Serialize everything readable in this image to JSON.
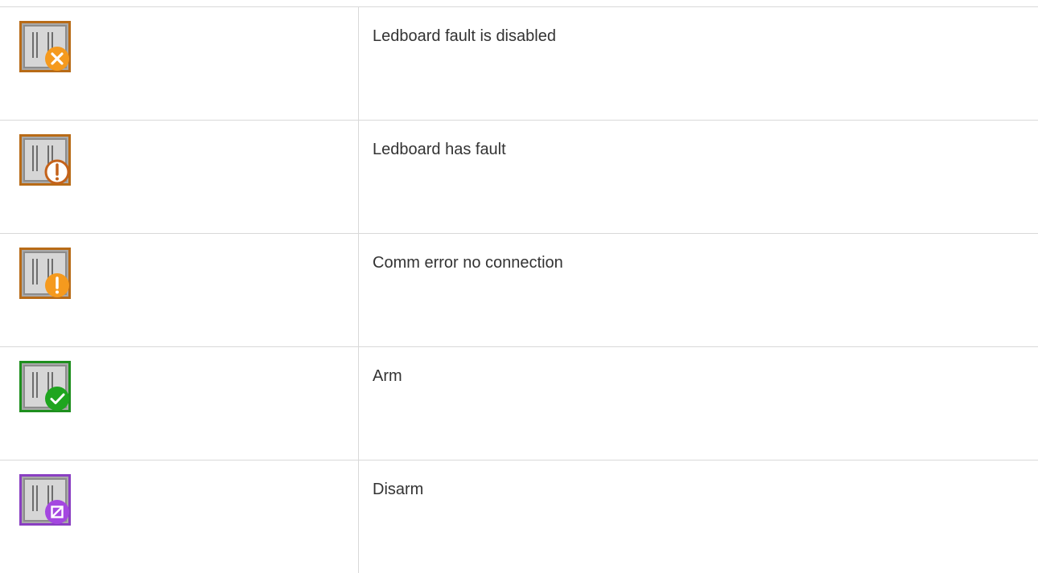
{
  "rows": [
    {
      "status": "fault-disabled",
      "description": "Ledboard fault is disabled",
      "frame_color": "#b86b17",
      "badge_color": "#f59a1e",
      "badge_icon": "x-icon"
    },
    {
      "status": "has-fault",
      "description": "Ledboard has fault",
      "frame_color": "#b86b17",
      "badge_color": "#ffffff",
      "badge_icon": "exclamation-outline-icon"
    },
    {
      "status": "comm-error",
      "description": "Comm error no connection",
      "frame_color": "#b86b17",
      "badge_color": "#f59a1e",
      "badge_icon": "exclamation-icon"
    },
    {
      "status": "arm",
      "description": "Arm",
      "frame_color": "#1e8f1e",
      "badge_color": "#1fa51f",
      "badge_icon": "check-icon"
    },
    {
      "status": "disarm",
      "description": "Disarm",
      "frame_color": "#8a3fc2",
      "badge_color": "#a447e0",
      "badge_icon": "slashed-square-icon"
    }
  ]
}
